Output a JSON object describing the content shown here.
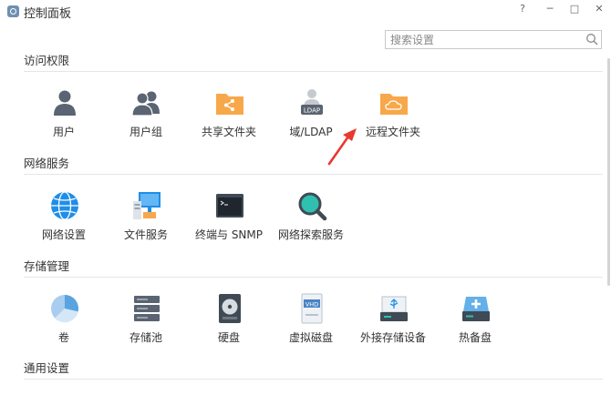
{
  "window": {
    "title": "控制面板",
    "help": "?",
    "minimize": "─",
    "maximize": "□",
    "close": "✕"
  },
  "search": {
    "placeholder": "搜索设置"
  },
  "sections": [
    {
      "title": "访问权限",
      "items": [
        {
          "label": "用户",
          "icon": "user-icon"
        },
        {
          "label": "用户组",
          "icon": "user-group-icon"
        },
        {
          "label": "共享文件夹",
          "icon": "shared-folder-icon"
        },
        {
          "label": "域/LDAP",
          "icon": "ldap-icon"
        },
        {
          "label": "远程文件夹",
          "icon": "remote-folder-icon"
        }
      ]
    },
    {
      "title": "网络服务",
      "items": [
        {
          "label": "网络设置",
          "icon": "globe-icon"
        },
        {
          "label": "文件服务",
          "icon": "file-service-icon"
        },
        {
          "label": "终端与 SNMP",
          "icon": "terminal-icon"
        },
        {
          "label": "网络探索服务",
          "icon": "discovery-icon"
        }
      ]
    },
    {
      "title": "存储管理",
      "items": [
        {
          "label": "卷",
          "icon": "volume-pie-icon"
        },
        {
          "label": "存储池",
          "icon": "storage-pool-icon"
        },
        {
          "label": "硬盘",
          "icon": "hard-disk-icon"
        },
        {
          "label": "虚拟磁盘",
          "icon": "vhd-icon"
        },
        {
          "label": "外接存储设备",
          "icon": "usb-storage-icon"
        },
        {
          "label": "热备盘",
          "icon": "hot-spare-icon"
        }
      ]
    },
    {
      "title": "通用设置",
      "items": []
    }
  ],
  "icon_text": {
    "ldap": "LDAP",
    "vhd": "VHD"
  },
  "colors": {
    "accent_orange": "#f7a84a",
    "user_gray": "#5a6472",
    "globe_blue": "#1f8ee8",
    "annotation_red": "#e8392f"
  }
}
